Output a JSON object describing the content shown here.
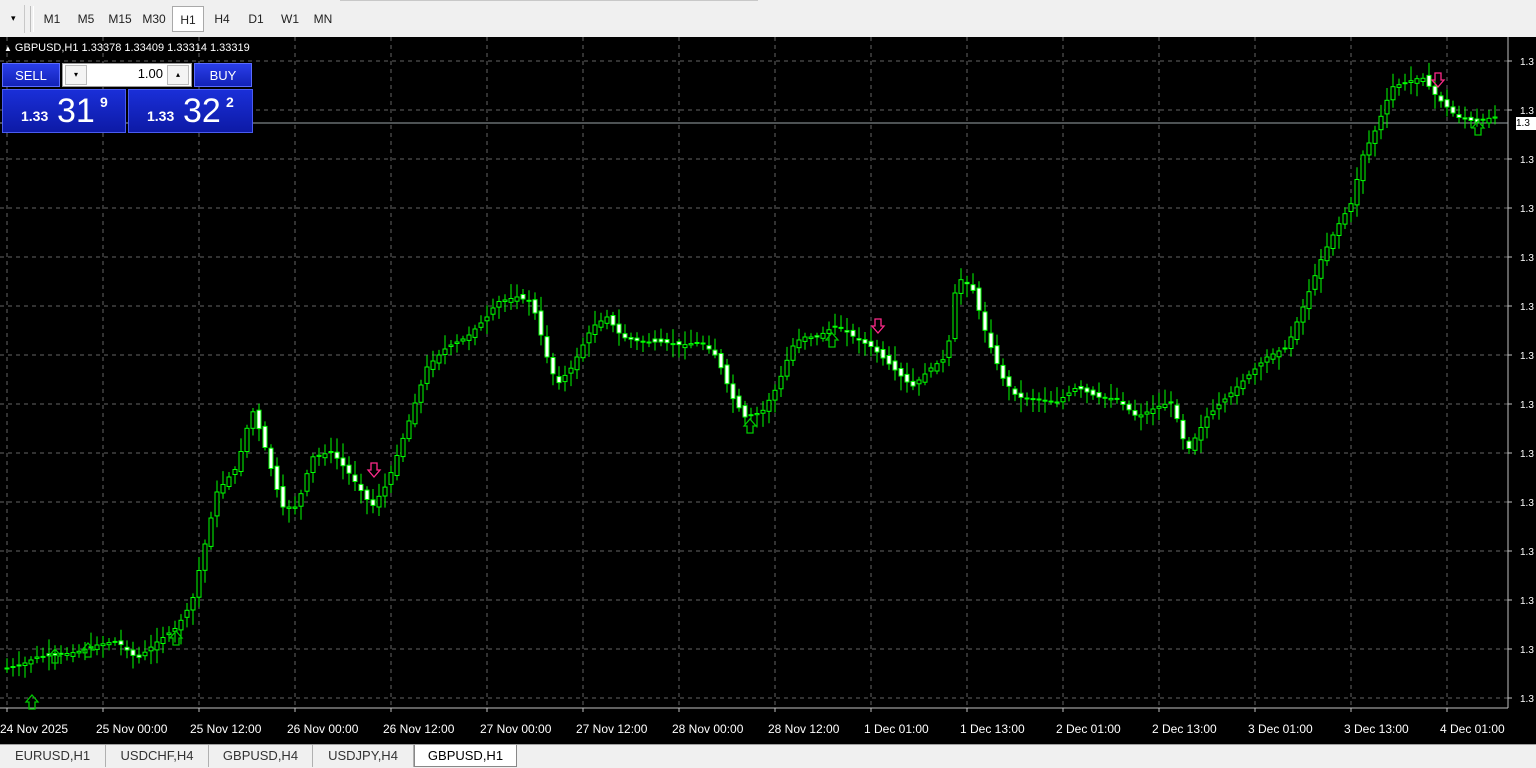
{
  "toolbar": {
    "dropdown_glyph": "▾",
    "timeframes": [
      "M1",
      "M5",
      "M15",
      "M30",
      "H1",
      "H4",
      "D1",
      "W1",
      "MN"
    ],
    "active_timeframe": "H1"
  },
  "chart": {
    "symbol_label": "GBPUSD,H1  1.33378 1.33409 1.33314 1.33319",
    "background": "#000000",
    "candle_color": "#00ff00",
    "grid_color": "#646464",
    "buy_arrow_color": "#00c800",
    "sell_arrow_color": "#ff2a8a",
    "bid_line_color": "#9aa3a8",
    "axis_value_fragment": "1.3",
    "current_price_fragment": "1.3",
    "date_labels": [
      "24 Nov 2025",
      "25 Nov 00:00",
      "25 Nov 12:00",
      "26 Nov 00:00",
      "26 Nov 12:00",
      "27 Nov 00:00",
      "27 Nov 12:00",
      "28 Nov 00:00",
      "28 Nov 12:00",
      "1 Dec 01:00",
      "1 Dec 13:00",
      "2 Dec 01:00",
      "2 Dec 13:00",
      "3 Dec 01:00",
      "3 Dec 13:00",
      "4 Dec 01:00"
    ]
  },
  "trade_panel": {
    "sell_label": "SELL",
    "buy_label": "BUY",
    "lot": "1.00",
    "lot_down_glyph": "▾",
    "lot_up_glyph": "▴",
    "bid_prefix": "1.33",
    "bid_big": "31",
    "bid_sup": "9",
    "ask_prefix": "1.33",
    "ask_big": "32",
    "ask_sup": "2"
  },
  "tabs": [
    "EURUSD,H1",
    "USDCHF,H4",
    "GBPUSD,H4",
    "USDJPY,H4",
    "GBPUSD,H1"
  ],
  "active_tab": "GBPUSD,H1"
}
